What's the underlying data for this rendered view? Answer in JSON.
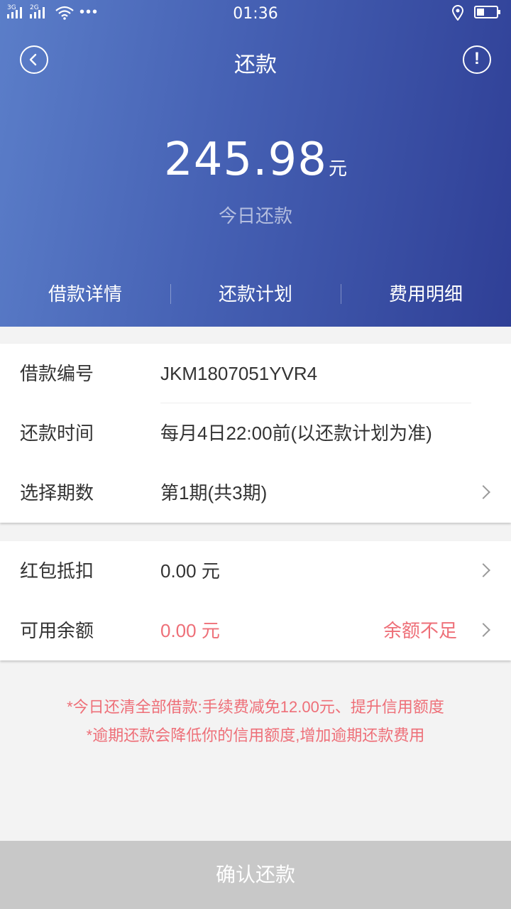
{
  "status_bar": {
    "network1": "3G",
    "network2": "2G",
    "more": "•••",
    "time": "01:36"
  },
  "header": {
    "title": "还款",
    "info_symbol": "!",
    "amount": "245.98",
    "amount_unit": "元",
    "amount_label": "今日还款",
    "tabs": [
      "借款详情",
      "还款计划",
      "费用明细"
    ]
  },
  "loan_info": {
    "rows": [
      {
        "label": "借款编号",
        "value": "JKM1807051YVR4"
      },
      {
        "label": "还款时间",
        "value": "每月4日22:00前(以还款计划为准)"
      },
      {
        "label": "选择期数",
        "value": "第1期(共3期)"
      }
    ]
  },
  "payment": {
    "rows": [
      {
        "label": "红包抵扣",
        "value": "0.00 元"
      },
      {
        "label": "可用余额",
        "value": "0.00 元",
        "warning": "余额不足"
      }
    ]
  },
  "notes": [
    "*今日还清全部借款:手续费减免12.00元、提升信用额度",
    "*逾期还款会降低你的信用额度,增加逾期还款费用"
  ],
  "confirm_label": "确认还款",
  "colors": {
    "header_start": "#5b7ec9",
    "header_end": "#2f3f96",
    "warning": "#ee6f78",
    "button_disabled": "#c8c8c8"
  }
}
